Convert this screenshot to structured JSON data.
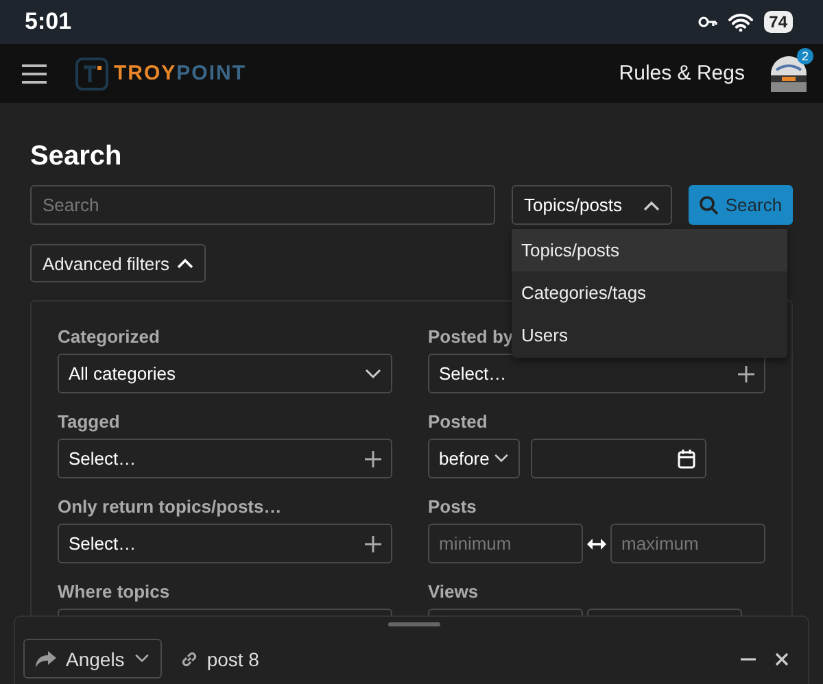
{
  "status_bar": {
    "time": "5:01",
    "battery": "74"
  },
  "header": {
    "logo": {
      "brand_highlight": "TROY",
      "brand_rest": "POINT"
    },
    "nav_link": "Rules & Regs",
    "notification_count": "2"
  },
  "page_title": "Search",
  "search": {
    "placeholder": "Search",
    "type_select": "Topics/posts",
    "type_select_expanded": true,
    "button": "Search"
  },
  "type_menu": [
    {
      "label": "Topics/posts",
      "selected": true
    },
    {
      "label": "Categories/tags",
      "selected": false
    },
    {
      "label": "Users",
      "selected": false
    }
  ],
  "advanced_filters": {
    "label": "Advanced filters",
    "expanded": true
  },
  "filters": {
    "left": [
      {
        "label": "Categorized",
        "kind": "dropdown",
        "value": "All categories"
      },
      {
        "label": "Tagged",
        "kind": "multiselect",
        "value": "Select…"
      },
      {
        "label": "Only return topics/posts…",
        "kind": "multiselect",
        "value": "Select…"
      },
      {
        "label": "Where topics",
        "kind": "blank"
      }
    ],
    "right": [
      {
        "label": "Posted by",
        "kind": "multiselect",
        "value": "Select…"
      },
      {
        "label": "Posted",
        "kind": "date",
        "qualifier": "before"
      },
      {
        "label": "Posts",
        "kind": "range",
        "min_placeholder": "minimum",
        "max_placeholder": "maximum"
      },
      {
        "label": "Views",
        "kind": "range"
      }
    ]
  },
  "composer": {
    "reply_target": "Angels",
    "link_text": "post 8"
  }
}
